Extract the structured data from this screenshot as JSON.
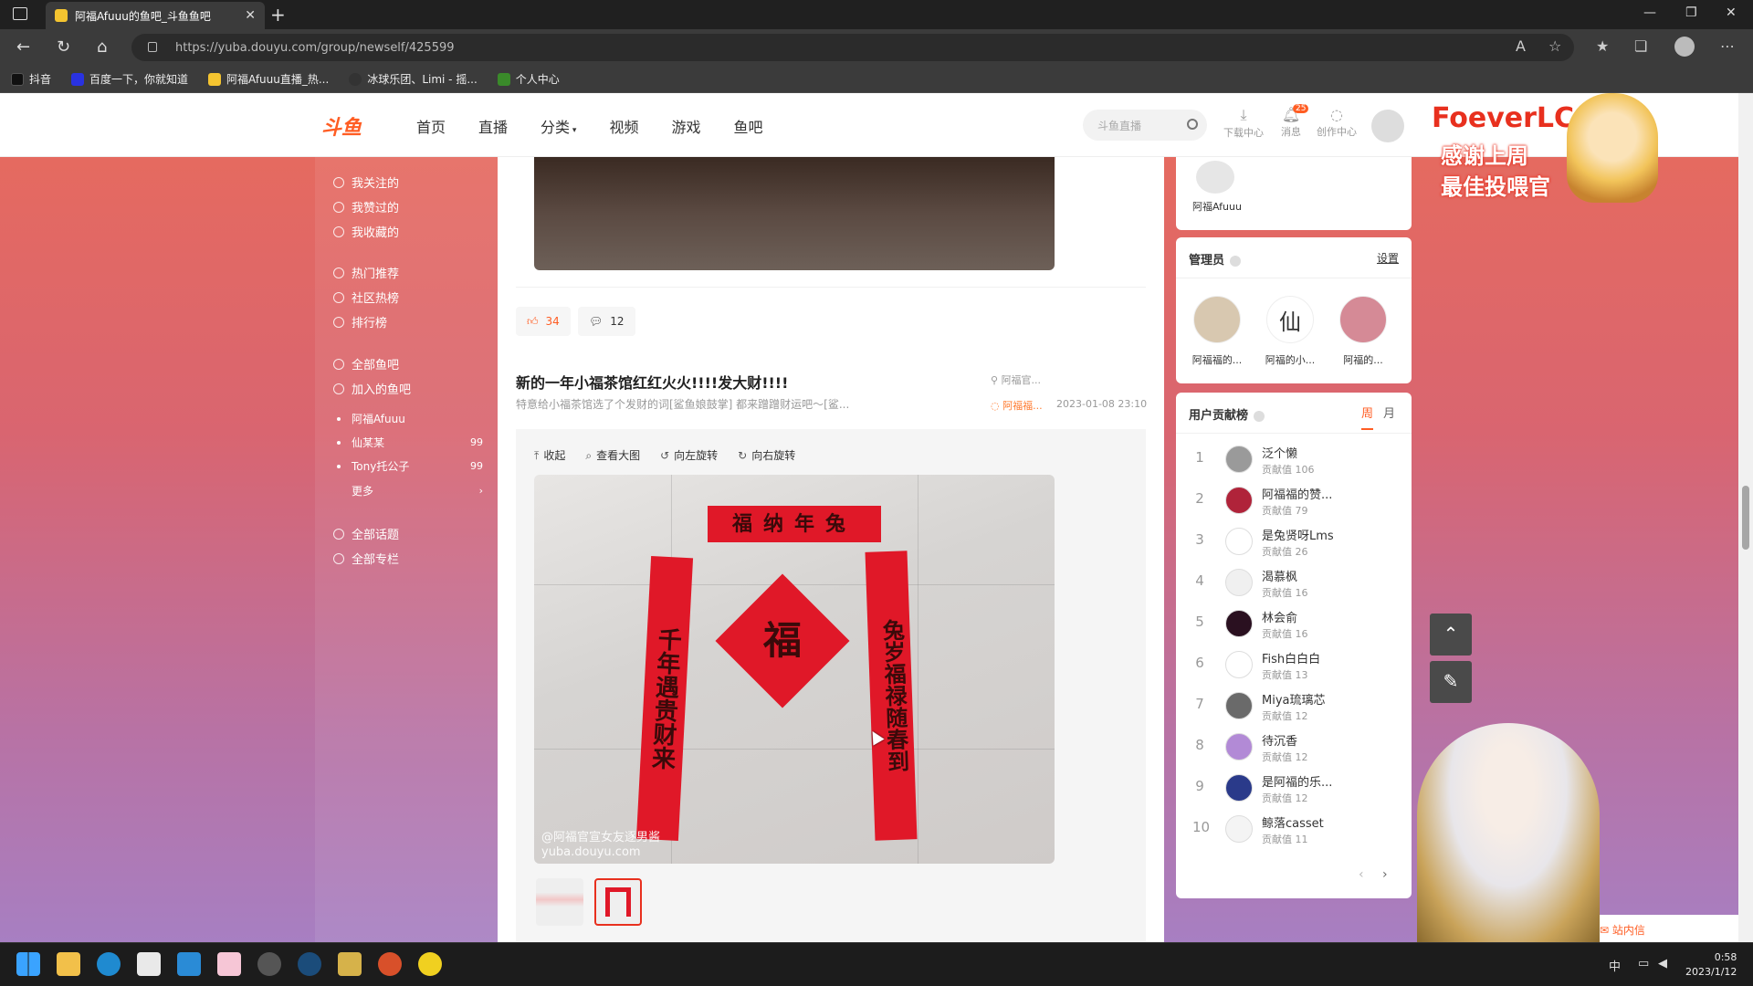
{
  "browser": {
    "tab_title": "阿福Afuuu的鱼吧_斗鱼鱼吧",
    "url": "https://yuba.douyu.com/group/newself/425599",
    "bookmarks": [
      "抖音",
      "百度一下，你就知道",
      "阿福Afuuu直播_热...",
      "冰球乐团、Limi - 摇...",
      "个人中心"
    ]
  },
  "header": {
    "nav": [
      "首页",
      "直播",
      "分类",
      "视频",
      "游戏",
      "鱼吧"
    ],
    "search_placeholder": "斗鱼直播",
    "icons": [
      {
        "label": "下载中心",
        "icon": "download-icon"
      },
      {
        "label": "消息",
        "icon": "bell-icon",
        "badge": "25"
      },
      {
        "label": "创作中心",
        "icon": "bulb-icon"
      }
    ]
  },
  "promo": {
    "title": "FoeverLC",
    "line1": "感谢上周",
    "line2": "最佳投喂官"
  },
  "sidebar": {
    "group1": [
      "我关注的",
      "我赞过的",
      "我收藏的"
    ],
    "group2": [
      "热门推荐",
      "社区热榜",
      "排行榜"
    ],
    "group3": [
      "全部鱼吧",
      "加入的鱼吧"
    ],
    "bars": [
      {
        "name": "阿福Afuuu",
        "count": ""
      },
      {
        "name": "仙某某",
        "count": "99"
      },
      {
        "name": "Tony托公子",
        "count": "99"
      }
    ],
    "more": "更多",
    "group4": [
      "全部话题",
      "全部专栏"
    ]
  },
  "post_actions": {
    "likes": "34",
    "comments": "12"
  },
  "post": {
    "title": "新的一年小福茶馆红红火火!!!!发大财!!!!",
    "summary": "特意给小福茶馆选了个发财的词[鲨鱼娘鼓掌] 都来蹭蹭财运吧～[鲨...",
    "author_top": "阿福官...",
    "author_tag": "阿福福...",
    "date": "2023-01-08 23:10",
    "toolbar": [
      "收起",
      "查看大图",
      "向左旋转",
      "向右旋转"
    ],
    "watermark1": "@阿福官宣女友逐男酱",
    "watermark2": "yuba.douyu.com",
    "couplet_top": "福纳年兔",
    "couplet_left": "千年遇贵财来",
    "couplet_right": "兔岁福禄随春到",
    "center": "福"
  },
  "owner": {
    "name": "阿福Afuuu"
  },
  "admins": {
    "title": "管理员",
    "settings": "设置",
    "list": [
      "阿福福的...",
      "阿福的小...",
      "阿福的..."
    ],
    "glyph": "仙"
  },
  "ranking": {
    "title": "用户贡献榜",
    "tabs": [
      "周",
      "月"
    ],
    "label": "贡献值",
    "items": [
      {
        "rank": "1",
        "name": "泛个懒",
        "value": "106",
        "color": "#9a9a9a"
      },
      {
        "rank": "2",
        "name": "阿福福的赞...",
        "value": "79",
        "color": "#b0233a"
      },
      {
        "rank": "3",
        "name": "是兔贤呀Lms",
        "value": "26",
        "color": "#ffffff"
      },
      {
        "rank": "4",
        "name": "渴慕枫",
        "value": "16",
        "color": "#f0f0f0"
      },
      {
        "rank": "5",
        "name": "林会俞",
        "value": "16",
        "color": "#2a1020"
      },
      {
        "rank": "6",
        "name": "Fish白白白",
        "value": "13",
        "color": "#ffffff"
      },
      {
        "rank": "7",
        "name": "Miya琉璃芯",
        "value": "12",
        "color": "#6a6a6a"
      },
      {
        "rank": "8",
        "name": "待沉香",
        "value": "12",
        "color": "#b28ad6"
      },
      {
        "rank": "9",
        "name": "是阿福的乐...",
        "value": "12",
        "color": "#2a3a8a"
      },
      {
        "rank": "10",
        "name": "鲸落casset",
        "value": "11",
        "color": "#f4f4f4"
      }
    ]
  },
  "site_msg": "站内信",
  "taskbar": {
    "time": "0:58",
    "date": "2023/1/12",
    "ime": "中"
  }
}
